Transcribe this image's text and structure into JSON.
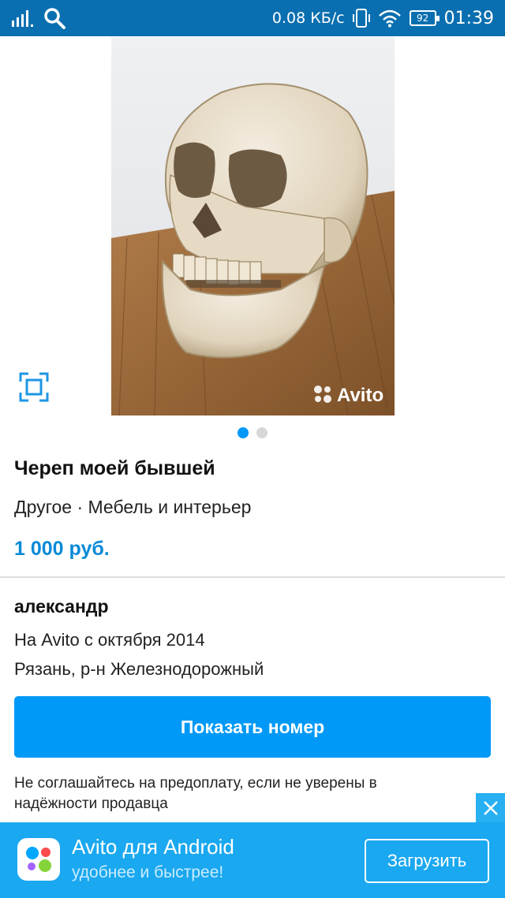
{
  "status_bar": {
    "net_speed": "0.08 КБ/с",
    "battery": "92",
    "time": "01:39"
  },
  "photo": {
    "watermark": "Avito",
    "page_count": 2,
    "active_page": 1
  },
  "listing": {
    "title": "Череп моей бывшей",
    "category": "Другое · Мебель и интерьер",
    "price": "1 000 руб."
  },
  "seller": {
    "name": "александр",
    "since": "На Avito с октября 2014",
    "location": "Рязань, р-н Железнодорожный"
  },
  "actions": {
    "show_number": "Показать номер"
  },
  "warning": "Не соглашайтесь на предоплату, если не уверены в надёжности продавца",
  "banner": {
    "title": "Avito для Android",
    "subtitle": "удобнее и быстрее!",
    "download": "Загрузить"
  },
  "colors": {
    "status_bar": "#0a6fb0",
    "accent": "#0099f7",
    "price": "#0a8ad8",
    "banner": "#1aa8f0"
  }
}
